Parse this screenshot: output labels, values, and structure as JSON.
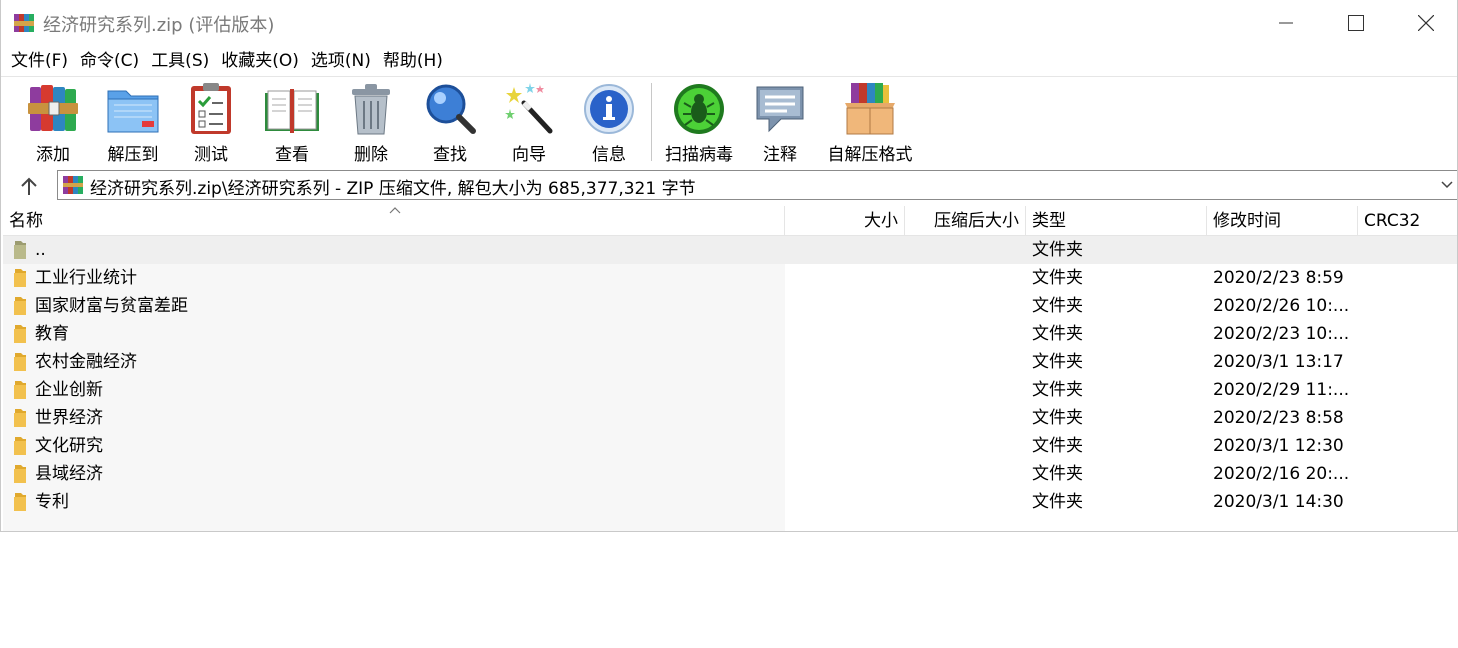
{
  "window": {
    "title": "经济研究系列.zip (评估版本)",
    "controls": [
      "minimize",
      "maximize",
      "close"
    ]
  },
  "menu": [
    "文件(F)",
    "命令(C)",
    "工具(S)",
    "收藏夹(O)",
    "选项(N)",
    "帮助(H)"
  ],
  "toolbar": {
    "buttons": [
      {
        "id": "add",
        "label": "添加",
        "icon": "books-icon"
      },
      {
        "id": "extract",
        "label": "解压到",
        "icon": "folder-extract-icon"
      },
      {
        "id": "test",
        "label": "测试",
        "icon": "clipboard-check-icon"
      },
      {
        "id": "view",
        "label": "查看",
        "icon": "open-book-icon"
      },
      {
        "id": "delete",
        "label": "删除",
        "icon": "trash-icon"
      },
      {
        "id": "find",
        "label": "查找",
        "icon": "magnifier-icon"
      },
      {
        "id": "wizard",
        "label": "向导",
        "icon": "magic-wand-icon"
      },
      {
        "id": "info",
        "label": "信息",
        "icon": "info-icon"
      },
      {
        "id": "virus",
        "label": "扫描病毒",
        "icon": "bug-icon"
      },
      {
        "id": "comment",
        "label": "注释",
        "icon": "comment-icon"
      },
      {
        "id": "sfx",
        "label": "自解压格式",
        "icon": "box-books-icon"
      }
    ]
  },
  "address": {
    "path": "经济研究系列.zip\\经济研究系列 - ZIP 压缩文件, 解包大小为 685,377,321 字节"
  },
  "columns": {
    "name": "名称",
    "size": "大小",
    "packed": "压缩后大小",
    "type": "类型",
    "modified": "修改时间",
    "crc": "CRC32"
  },
  "rows": [
    {
      "name": "..",
      "type": "文件夹",
      "modified": "",
      "parent": true
    },
    {
      "name": "工业行业统计",
      "type": "文件夹",
      "modified": "2020/2/23 8:59"
    },
    {
      "name": "国家财富与贫富差距",
      "type": "文件夹",
      "modified": "2020/2/26 10:..."
    },
    {
      "name": "教育",
      "type": "文件夹",
      "modified": "2020/2/23 10:..."
    },
    {
      "name": "农村金融经济",
      "type": "文件夹",
      "modified": "2020/3/1 13:17"
    },
    {
      "name": "企业创新",
      "type": "文件夹",
      "modified": "2020/2/29 11:..."
    },
    {
      "name": "世界经济",
      "type": "文件夹",
      "modified": "2020/2/23 8:58"
    },
    {
      "name": "文化研究",
      "type": "文件夹",
      "modified": "2020/3/1 12:30"
    },
    {
      "name": "县域经济",
      "type": "文件夹",
      "modified": "2020/2/16 20:..."
    },
    {
      "name": "专利",
      "type": "文件夹",
      "modified": "2020/3/1 14:30"
    }
  ],
  "colors": {
    "folder": "#f2c14e",
    "parent_folder": "#b9b98a",
    "selected_row": "#efefef",
    "title_text": "#7a7a7a"
  }
}
